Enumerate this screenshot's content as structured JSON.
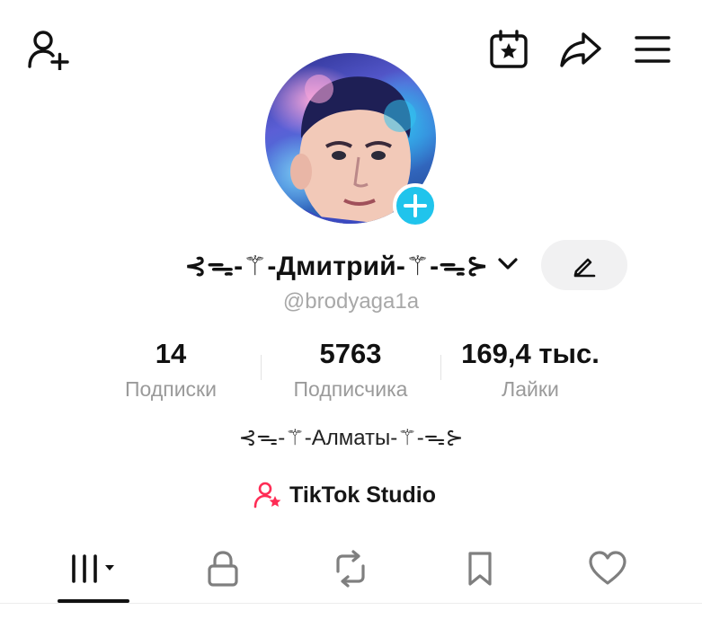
{
  "profile": {
    "display_name": "⊰ᯓ-⚚-Дмитрий-⚚-ᯓ⊱",
    "username": "@brodyaga1a",
    "bio": "⊰ᯓ-⚚-Алматы-⚚-ᯓ⊱"
  },
  "stats": [
    {
      "value": "14",
      "label": "Подписки"
    },
    {
      "value": "5763",
      "label": "Подписчика"
    },
    {
      "value": "169,4 тыс.",
      "label": "Лайки"
    }
  ],
  "studio": {
    "label": "TikTok Studio"
  },
  "colors": {
    "accent_blue": "#20c4ec",
    "studio_icon": "#fe2c55",
    "text_primary": "#111111",
    "text_secondary": "#9a9a9a"
  },
  "icons": {
    "top_left": "add-user-icon",
    "top_right": [
      "calendar-star-icon",
      "share-icon",
      "menu-icon"
    ],
    "tabs": [
      "videos-grid-icon",
      "lock-icon",
      "repost-icon",
      "bookmark-icon",
      "heart-icon"
    ]
  }
}
